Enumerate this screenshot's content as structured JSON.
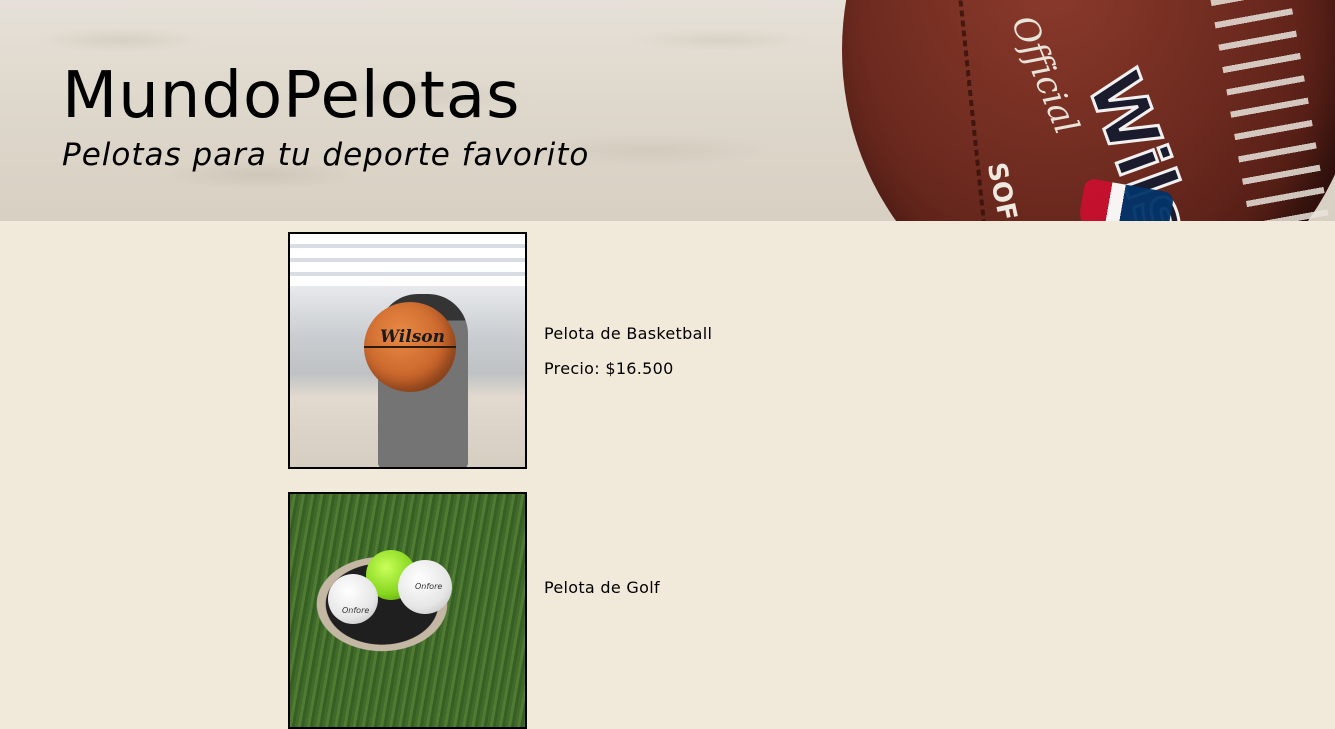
{
  "header": {
    "title": "MundoPelotas",
    "subtitle": "Pelotas para tu deporte favorito",
    "ball_official_text": "Official",
    "ball_brand_text": "Wilson",
    "ball_sub_text": "SOF"
  },
  "products": [
    {
      "name": "Pelota de Basketball",
      "price": "Precio: $16.500",
      "image_icon": "basketball-photo",
      "ball_brand_text": "Wilson"
    },
    {
      "name": "Pelota de Golf",
      "image_icon": "golf-balls-photo",
      "ball_brand_text": "Onfore"
    }
  ],
  "colors": {
    "page_background": "#f1e9d9",
    "text": "#000000"
  }
}
